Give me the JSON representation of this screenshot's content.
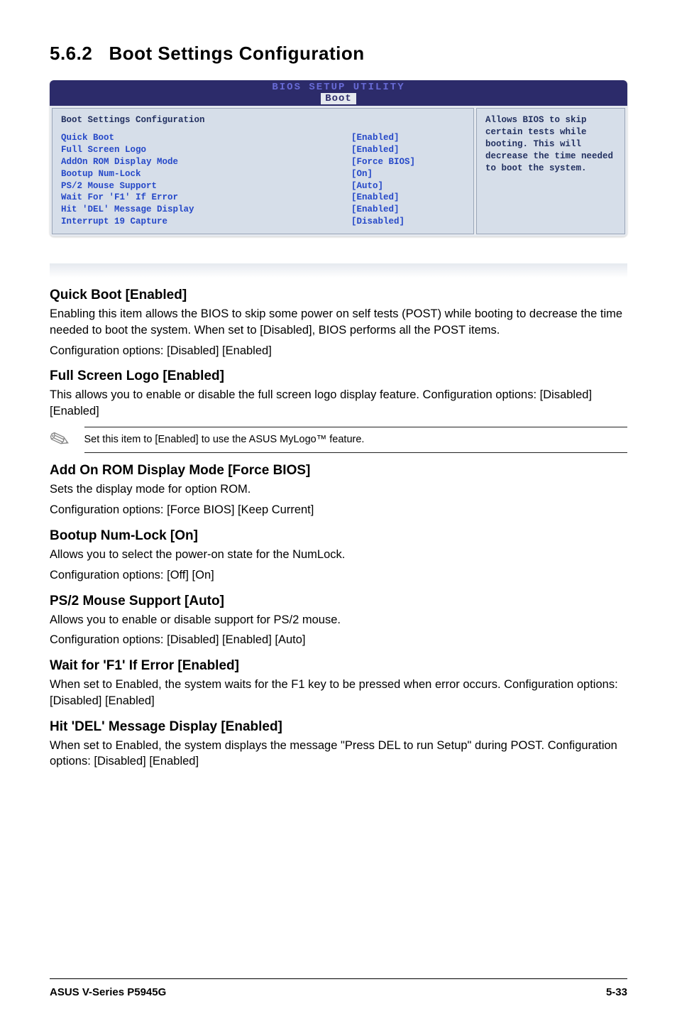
{
  "section": {
    "number": "5.6.2",
    "title": "Boot Settings Configuration"
  },
  "bios": {
    "header_line1": "BIOS SETUP UTILITY",
    "header_tab": "Boot",
    "left_title": "Boot Settings Configuration",
    "rows": [
      {
        "label": "Quick Boot",
        "value": "[Enabled]"
      },
      {
        "label": "Full Screen Logo",
        "value": "[Enabled]"
      },
      {
        "label": "AddOn ROM Display Mode",
        "value": "[Force BIOS]"
      },
      {
        "label": "Bootup Num-Lock",
        "value": "[On]"
      },
      {
        "label": "PS/2 Mouse Support",
        "value": "[Auto]"
      },
      {
        "label": "Wait For 'F1' If Error",
        "value": "[Enabled]"
      },
      {
        "label": "Hit 'DEL' Message Display",
        "value": "[Enabled]"
      },
      {
        "label": "Interrupt 19 Capture",
        "value": "[Disabled]"
      }
    ],
    "help": "Allows BIOS to skip certain tests while booting. This will decrease the time needed to boot the system."
  },
  "items": {
    "quick_boot": {
      "heading": "Quick Boot [Enabled]",
      "p1": "Enabling this item allows the BIOS to skip some power on self tests (POST) while booting to decrease the time needed to boot the system. When set to [Disabled], BIOS performs all the POST items.",
      "p2": "Configuration options: [Disabled] [Enabled]"
    },
    "full_screen_logo": {
      "heading": "Full Screen Logo [Enabled]",
      "p1": "This allows you to enable or disable the full screen logo display feature. Configuration options: [Disabled] [Enabled]",
      "note": "Set this item to [Enabled] to use the ASUS MyLogo™ feature."
    },
    "addon_rom": {
      "heading": "Add On ROM Display Mode [Force BIOS]",
      "p1": "Sets the display mode for option ROM.",
      "p2": "Configuration options: [Force BIOS] [Keep Current]"
    },
    "bootup_num": {
      "heading": "Bootup Num-Lock [On]",
      "p1": "Allows you to select the power-on state for the NumLock.",
      "p2": "Configuration options: [Off] [On]"
    },
    "ps2_mouse": {
      "heading": "PS/2 Mouse Support [Auto]",
      "p1": "Allows you to enable or disable support for PS/2 mouse.",
      "p2": "Configuration options: [Disabled] [Enabled] [Auto]"
    },
    "wait_f1": {
      "heading": "Wait for 'F1' If Error [Enabled]",
      "p1": "When set to Enabled, the system waits for the F1 key to be pressed when error occurs. Configuration options: [Disabled] [Enabled]"
    },
    "hit_del": {
      "heading": "Hit 'DEL' Message Display [Enabled]",
      "p1": "When set to Enabled, the system displays the message \"Press DEL to run Setup\" during POST. Configuration options: [Disabled] [Enabled]"
    }
  },
  "footer": {
    "left": "ASUS V-Series P5945G",
    "right": "5-33"
  }
}
